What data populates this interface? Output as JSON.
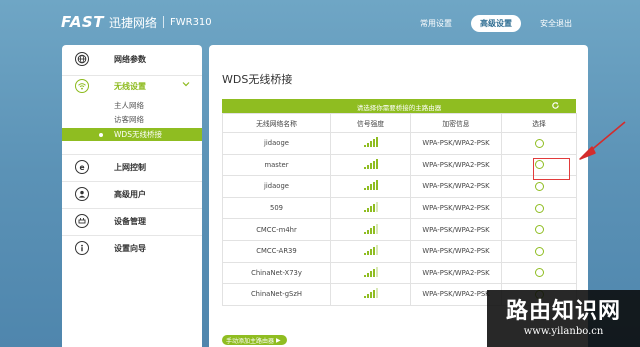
{
  "header": {
    "logo_brand": "FAST",
    "logo_cn": "迅捷网络",
    "model": "FWR310",
    "nav": [
      "常用设置",
      "高级设置",
      "安全退出"
    ],
    "active_nav": "高级设置"
  },
  "sidebar": {
    "items": [
      {
        "label": "网络参数",
        "icon": "globe-icon"
      },
      {
        "label": "无线设置",
        "icon": "wifi-icon"
      },
      {
        "label": "上网控制",
        "icon": "internet-control-icon"
      },
      {
        "label": "高级用户",
        "icon": "user-icon"
      },
      {
        "label": "设备管理",
        "icon": "device-icon"
      },
      {
        "label": "设置向导",
        "icon": "info-icon"
      }
    ],
    "sub_items": [
      "主人网络",
      "访客网络",
      "WDS无线桥接"
    ],
    "selected_item": "无线设置",
    "active_sub_item": "WDS无线桥接"
  },
  "main": {
    "title": "WDS无线桥接",
    "table_header_text": "请选择你需要桥接的主路由器",
    "columns": [
      "无线网络名称",
      "信号强度",
      "加密信息",
      "选择"
    ],
    "rows": [
      {
        "name": "jidaoge",
        "signal": 5,
        "security": "WPA-PSK/WPA2-PSK"
      },
      {
        "name": "master",
        "signal": 5,
        "security": "WPA-PSK/WPA2-PSK"
      },
      {
        "name": "jidaoge",
        "signal": 5,
        "security": "WPA-PSK/WPA2-PSK"
      },
      {
        "name": "509",
        "signal": 4,
        "security": "WPA-PSK/WPA2-PSK"
      },
      {
        "name": "CMCC-m4hr",
        "signal": 4,
        "security": "WPA-PSK/WPA2-PSK"
      },
      {
        "name": "CMCC-AR39",
        "signal": 4,
        "security": "WPA-PSK/WPA2-PSK"
      },
      {
        "name": "ChinaNet-X73y",
        "signal": 4,
        "security": "WPA-PSK/WPA2-PSK"
      },
      {
        "name": "ChinaNet-gSzH",
        "signal": 4,
        "security": "WPA-PSK/WPA2-PSK"
      }
    ],
    "add_button": "手动添加主路由器",
    "highlighted_row": "master"
  },
  "watermark": {
    "title": "路由知识网",
    "url": "www.yilanbo.cn"
  },
  "colors": {
    "accent": "#8fbd21",
    "header_bg": "#5b92b6",
    "highlight": "#e23b3b"
  }
}
